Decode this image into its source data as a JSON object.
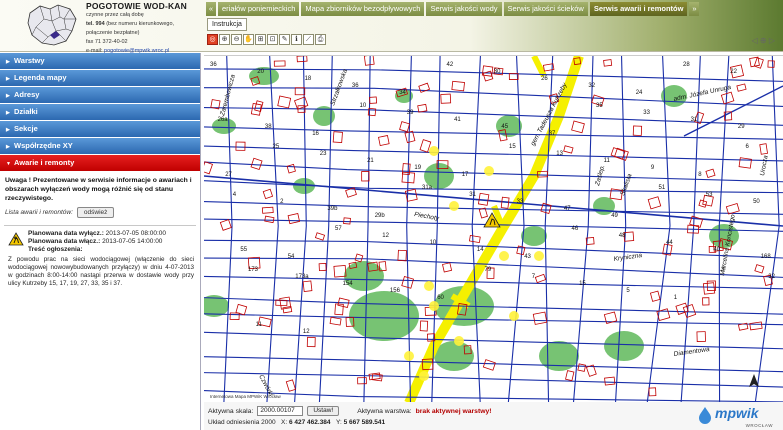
{
  "header": {
    "title": "POGOTOWIE WOD-KAN",
    "line1": "czynne przez całą dobę",
    "tel_label": "tel. 994",
    "tel_note": "(bez numeru kierunkowego,",
    "line3": "połączenie bezpłatne)",
    "fax": "fax 71 372-40-02",
    "email_label": "e-mail: ",
    "email": "pogotowie@mpwik.wroc.pl"
  },
  "tabs": [
    {
      "label": "«"
    },
    {
      "label": "eriałów poniemieckich"
    },
    {
      "label": "Mapa zbiorników bezodpływowych"
    },
    {
      "label": "Serwis jakości wody"
    },
    {
      "label": "Serwis jakości ścieków"
    },
    {
      "label": "Serwis awarii i remontów"
    },
    {
      "label": "»"
    }
  ],
  "instruction_label": "Instrukcja",
  "toolbar_icons": [
    "target-icon",
    "zoom-in-icon",
    "zoom-out-icon",
    "pan-hand-icon",
    "zoom-window-icon",
    "zoom-extent-icon",
    "measure-icon",
    "identify-icon",
    "ruler-icon",
    "print-icon"
  ],
  "toolbar_glyphs": [
    "◎",
    "⊕",
    "⊖",
    "✋",
    "⊞",
    "⊡",
    "✎",
    "ℹ",
    "⟋",
    "⎙"
  ],
  "nav_glyphs": "◁ ⊕ ▷",
  "sidebar": {
    "items": [
      {
        "label": "Warstwy"
      },
      {
        "label": "Legenda mapy"
      },
      {
        "label": "Adresy"
      },
      {
        "label": "Działki"
      },
      {
        "label": "Sekcje"
      },
      {
        "label": "Współrzędne XY"
      },
      {
        "label": "Awarie i remonty"
      }
    ],
    "notice": "Uwaga ! Prezentowane w serwisie informacje o awariach i obszarach wyłączeń wody mogą różnić się od stanu rzeczywistego.",
    "list_label": "Lista awarii i remontów:",
    "refresh_label": "odśwież",
    "outage": {
      "start_label": "Planowana data wyłącz.:",
      "start": "2013-07-05 08:00:00",
      "end_label": "Planowana data włącz.:",
      "end": "2013-07-05 14:00:00",
      "content_label": "Treść ogłoszenia:",
      "description": "Z powodu prac na sieci wodociągowej (włączenie do sieci wodociągowej nowowybudowanych przyłączy) w dniu 4-07-2013 w godzinach 8:00-14:00 nastąpi przerwa w dostawie wody przy ulicy Kutrzeby 15, 17, 19, 27, 33, 35 i 37."
    }
  },
  "map": {
    "streets": [
      "gen. Tadeusza Kutrzeby",
      "adm. Józefa Unruga",
      "Piechoty",
      "Kryniczna",
      "Diamentowa",
      "Skalista",
      "Zaślep.",
      "Zarembowicza",
      "Czwórki",
      "Strzałkowska",
      "Urocza",
      "Marcelina Koncistego"
    ],
    "numbers": [
      "36",
      "20",
      "18",
      "36",
      "34",
      "42",
      "30",
      "26",
      "32",
      "24",
      "28",
      "22",
      "26a",
      "38",
      "16",
      "10",
      "39",
      "41",
      "45",
      "37",
      "35",
      "33",
      "31",
      "29",
      "27",
      "25",
      "23",
      "21",
      "19",
      "17",
      "15",
      "13",
      "11",
      "9",
      "8",
      "6",
      "4",
      "2",
      "39b",
      "29b",
      "31a",
      "31",
      "33",
      "47",
      "49",
      "51",
      "53",
      "50",
      "55",
      "54",
      "57",
      "12",
      "10",
      "14",
      "43",
      "46",
      "48",
      "44",
      "40",
      "168",
      "173",
      "173a",
      "154",
      "156",
      "60",
      "79",
      "7",
      "15",
      "5",
      "1",
      "3",
      "32",
      "11",
      "12"
    ],
    "credit": "Internetowa Mapa MPWiK Wrocław"
  },
  "status": {
    "scale_label": "Aktywna skala:",
    "scale_value": "2000.00107",
    "set_label": "Ustaw!",
    "layer_label": "Aktywna warstwa:",
    "layer_value": "brak aktywnej warstwy!",
    "ref_label": "Układ odniesienia 2000",
    "x_label": "X:",
    "x_value": "6 427 462.384",
    "y_label": "Y:",
    "y_value": "5 667 589.541"
  },
  "brand": {
    "name": "mpwik",
    "sub": "WROCŁAW"
  },
  "colors": {
    "accordion": "#2c68b0",
    "active_accordion": "#c00000",
    "pipe": "#1a2fa8",
    "building": "#c00000",
    "green": "#5fb85a",
    "road": "#f5f000"
  }
}
